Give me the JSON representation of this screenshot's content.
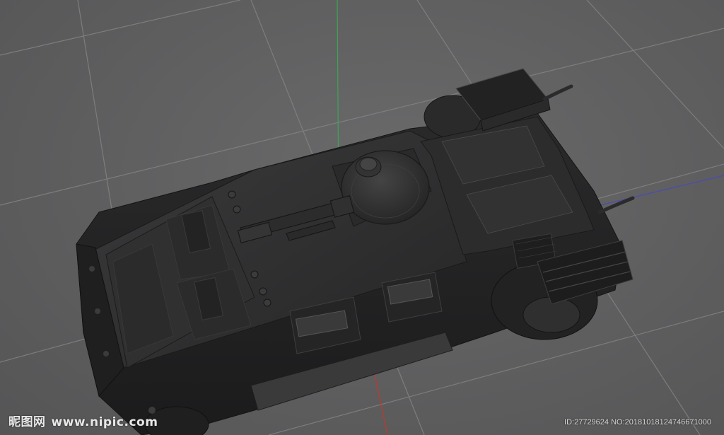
{
  "viewport": {
    "background_color": "#5f5f60",
    "grid_color": "#8a8a8b",
    "axis_colors": {
      "x": "#c0392b",
      "y": "#3aa655",
      "z": "#4a4ab8"
    },
    "model_color": "#2d2d2e"
  },
  "watermark": {
    "left_logo": "昵图网",
    "left_url": "www.nipic.com",
    "right_id": "ID:27729624 NO:20181018124746671000"
  }
}
